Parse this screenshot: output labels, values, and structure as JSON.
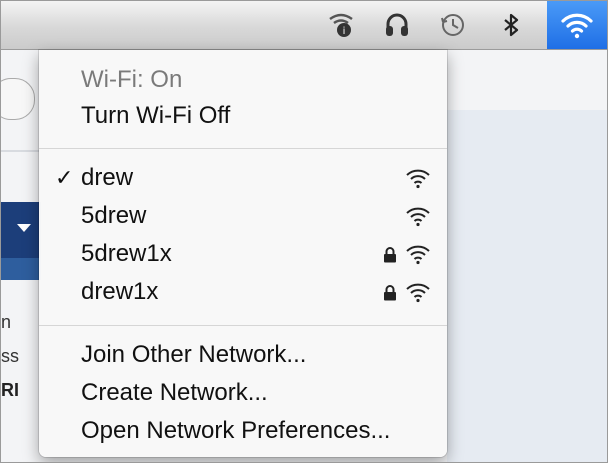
{
  "menu": {
    "status": "Wi-Fi: On",
    "toggle": "Turn Wi-Fi Off",
    "networks": [
      {
        "name": "drew",
        "selected": true,
        "locked": false
      },
      {
        "name": "5drew",
        "selected": false,
        "locked": false
      },
      {
        "name": "5drew1x",
        "selected": false,
        "locked": true
      },
      {
        "name": "drew1x",
        "selected": false,
        "locked": true
      }
    ],
    "check_glyph": "✓",
    "join_other": "Join Other Network...",
    "create": "Create Network...",
    "preferences": "Open Network Preferences..."
  },
  "menubar": {
    "icons": [
      "time-machine-icon",
      "headphones-icon",
      "clock-icon",
      "bluetooth-icon",
      "wifi-icon"
    ],
    "wifi_active_color": "#2b7cf0"
  },
  "background": {
    "partial_text": [
      "n",
      "ss",
      "RI"
    ]
  }
}
